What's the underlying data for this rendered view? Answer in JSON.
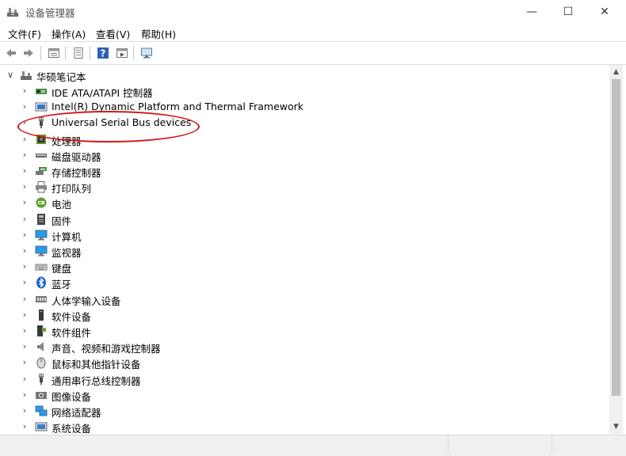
{
  "window": {
    "title": "设备管理器",
    "controls": {
      "minimize": "—",
      "maximize": "☐",
      "close": "✕"
    }
  },
  "menu": [
    "文件(F)",
    "操作(A)",
    "查看(V)",
    "帮助(H)"
  ],
  "toolbar_icons": [
    "back-arrow-icon",
    "forward-arrow-icon",
    "properties-icon",
    "update-driver-icon",
    "help-icon",
    "action-view-icon",
    "monitor-scan-icon"
  ],
  "tree": {
    "root": {
      "label": "华硕笔记本",
      "icon": "computer-icon",
      "expanded": true
    },
    "items": [
      {
        "label": "IDE ATA/ATAPI 控制器",
        "icon": "ide-controller-icon"
      },
      {
        "label": "Intel(R) Dynamic Platform and Thermal Framework",
        "icon": "thermal-framework-icon"
      },
      {
        "label": "Universal Serial Bus devices",
        "icon": "usb-plug-icon"
      },
      {
        "label": "处理器",
        "icon": "processor-icon"
      },
      {
        "label": "磁盘驱动器",
        "icon": "disk-drive-icon"
      },
      {
        "label": "存储控制器",
        "icon": "storage-controller-icon"
      },
      {
        "label": "打印队列",
        "icon": "printer-icon"
      },
      {
        "label": "电池",
        "icon": "battery-icon"
      },
      {
        "label": "固件",
        "icon": "firmware-icon"
      },
      {
        "label": "计算机",
        "icon": "monitor-icon"
      },
      {
        "label": "监视器",
        "icon": "monitor-icon"
      },
      {
        "label": "键盘",
        "icon": "keyboard-icon"
      },
      {
        "label": "蓝牙",
        "icon": "bluetooth-icon"
      },
      {
        "label": "人体学输入设备",
        "icon": "hid-icon"
      },
      {
        "label": "软件设备",
        "icon": "software-device-icon"
      },
      {
        "label": "软件组件",
        "icon": "software-component-icon"
      },
      {
        "label": "声音、视频和游戏控制器",
        "icon": "speaker-icon"
      },
      {
        "label": "鼠标和其他指针设备",
        "icon": "mouse-icon"
      },
      {
        "label": "通用串行总线控制器",
        "icon": "usb-plug-icon"
      },
      {
        "label": "图像设备",
        "icon": "camera-icon"
      },
      {
        "label": "网络适配器",
        "icon": "network-adapter-icon"
      },
      {
        "label": "系统设备",
        "icon": "system-device-icon"
      }
    ]
  },
  "colors": {
    "annotation": "#d21818",
    "selection": "#0078d7"
  }
}
